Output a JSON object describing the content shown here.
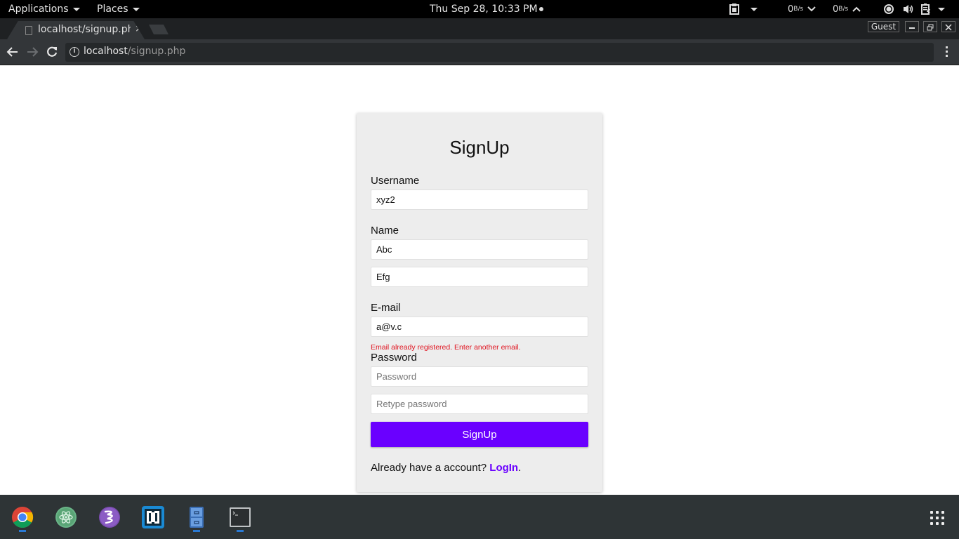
{
  "topbar": {
    "applications_label": "Applications",
    "places_label": "Places",
    "clock": "Thu Sep 28, 10:33 PM",
    "net_down_value": "0",
    "net_down_unit": "B/s",
    "net_up_value": "0",
    "net_up_unit": "B/s",
    "icons": [
      "clipboard-icon",
      "network-down-icon",
      "network-up-icon",
      "location-icon",
      "volume-icon",
      "battery-icon"
    ]
  },
  "browser": {
    "tab_title": "localhost/signup.php",
    "tab_close": "×",
    "profile_label": "Guest",
    "minimize_label": "—",
    "restore_label": "❐",
    "close_label": "✕",
    "back_label": "←",
    "forward_label": "→",
    "reload_label": "⟳",
    "info_label": "i",
    "url_host": "localhost",
    "url_path": "/signup.php"
  },
  "form": {
    "title": "SignUp",
    "username_label": "Username",
    "username_value": "xyz2",
    "name_label": "Name",
    "first_name_value": "Abc",
    "last_name_value": "Efg",
    "email_label": "E-mail",
    "email_value": "a@v.c",
    "email_error": "Email already registered. Enter another email.",
    "password_label": "Password",
    "password_placeholder": "Password",
    "retype_placeholder": "Retype password",
    "submit_label": "SignUp",
    "footer_text": "Already have a account? ",
    "login_link": "LogIn",
    "footer_end": ".",
    "accent_color": "#6a00ff",
    "error_color": "#e0131f"
  },
  "dock": {
    "items": [
      {
        "name": "chrome",
        "running": true
      },
      {
        "name": "atom",
        "running": false
      },
      {
        "name": "emacs",
        "running": false
      },
      {
        "name": "brackets",
        "running": false
      },
      {
        "name": "file-manager",
        "running": true
      },
      {
        "name": "terminal",
        "running": true
      }
    ]
  }
}
